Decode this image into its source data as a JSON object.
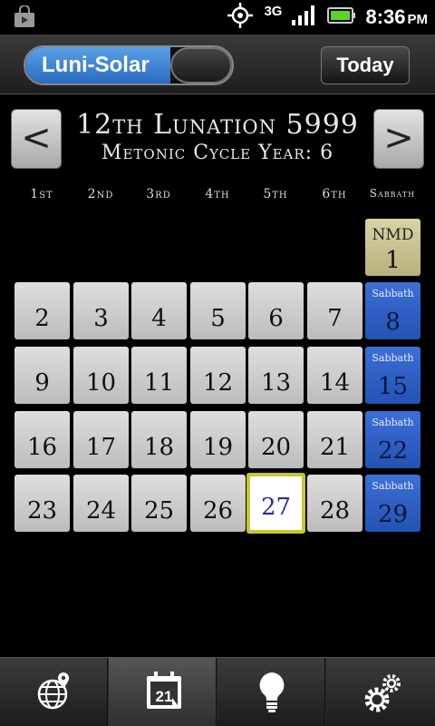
{
  "status_bar": {
    "network": "3G",
    "time": "8:36",
    "ampm": "PM"
  },
  "toolbar": {
    "toggle_label": "Luni-Solar",
    "today_label": "Today"
  },
  "header": {
    "prev_label": "<",
    "next_label": ">",
    "title": "12th Lunation 5999",
    "subtitle": "Metonic Cycle Year: 6"
  },
  "day_headers": [
    "1st",
    "2nd",
    "3rd",
    "4th",
    "5th",
    "6th",
    "Sabbath"
  ],
  "calendar": {
    "nmd_label": "NMD",
    "sabbath_label": "Sabbath",
    "today_day": "27",
    "days": [
      "1",
      "2",
      "3",
      "4",
      "5",
      "6",
      "7",
      "8",
      "9",
      "10",
      "11",
      "12",
      "13",
      "14",
      "15",
      "16",
      "17",
      "18",
      "19",
      "20",
      "21",
      "22",
      "23",
      "24",
      "25",
      "26",
      "27",
      "28",
      "29"
    ]
  },
  "tabbar": {
    "tabs": [
      {
        "icon": "globe-icon"
      },
      {
        "icon": "calendar-icon",
        "icon_text": "21"
      },
      {
        "icon": "lightbulb-icon"
      },
      {
        "icon": "gears-icon"
      }
    ],
    "active_index": 1
  },
  "colors": {
    "sabbath": "#2f5fc8",
    "nmd": "#c9c390",
    "today_border": "#c9c62b",
    "day_cell": "#cccccc"
  }
}
